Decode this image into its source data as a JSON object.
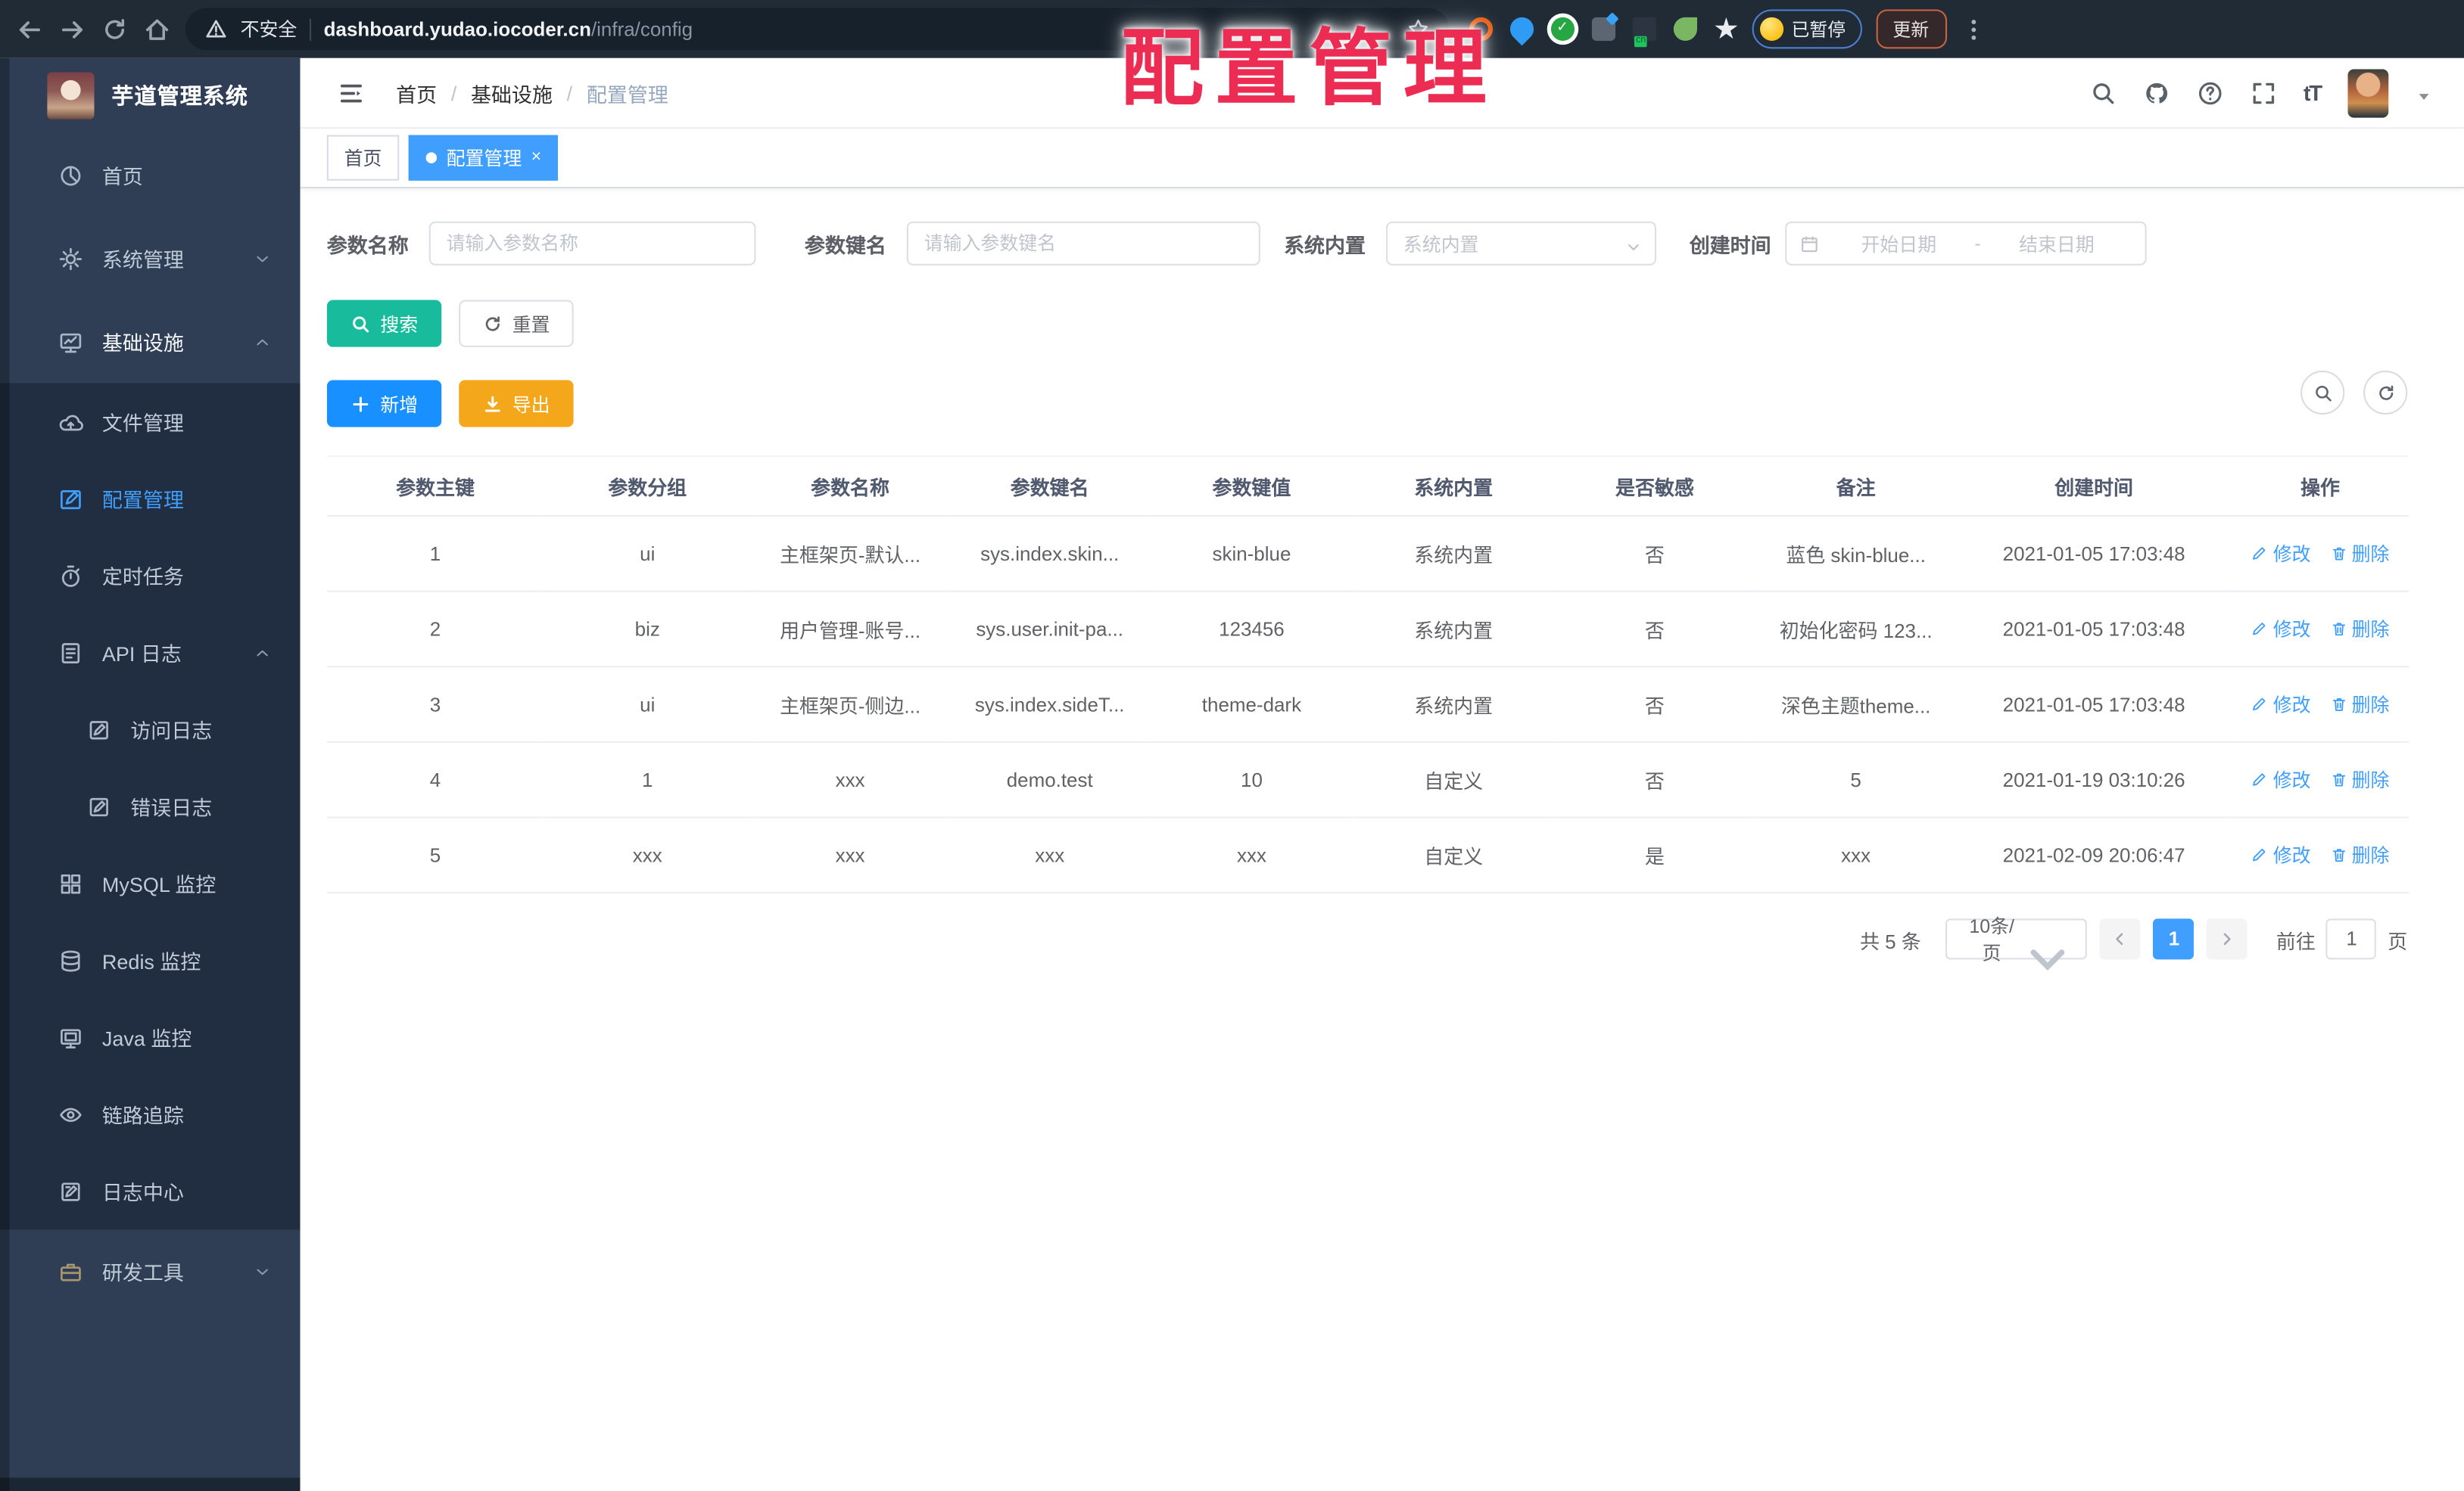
{
  "watermark": "配置管理",
  "browser": {
    "security_label": "不安全",
    "url_host": "dashboard.yudao.iocoder.cn",
    "url_path": "/infra/config",
    "paused_label": "已暂停",
    "update_label": "更新",
    "extensions": [
      "ext-orange-ring-icon",
      "ext-blue-pin-icon",
      "ext-green-check-icon",
      "ext-gray-blue-icon",
      "ext-cn-badge-icon",
      "ext-green-leaf-icon",
      "ext-puzzle-icon"
    ]
  },
  "sidebar": {
    "title": "芋道管理系统",
    "menu": [
      {
        "label": "首页",
        "icon": "dashboard-icon",
        "indent": 0,
        "dark": false,
        "chevron": null,
        "active": false,
        "open": false
      },
      {
        "label": "系统管理",
        "icon": "gear-icon",
        "indent": 0,
        "dark": false,
        "chevron": "down",
        "active": false,
        "open": false
      },
      {
        "label": "基础设施",
        "icon": "monitor-icon",
        "indent": 0,
        "dark": false,
        "chevron": "up",
        "active": false,
        "open": true
      },
      {
        "label": "文件管理",
        "icon": "cloud-upload-icon",
        "indent": 1,
        "dark": true,
        "chevron": null,
        "active": false,
        "open": false
      },
      {
        "label": "配置管理",
        "icon": "edit-square-icon",
        "indent": 1,
        "dark": true,
        "chevron": null,
        "active": true,
        "open": false
      },
      {
        "label": "定时任务",
        "icon": "timer-icon",
        "indent": 1,
        "dark": true,
        "chevron": null,
        "active": false,
        "open": false
      },
      {
        "label": "API 日志",
        "icon": "api-log-icon",
        "indent": 1,
        "dark": true,
        "chevron": "up",
        "active": false,
        "open": false
      },
      {
        "label": "访问日志",
        "icon": "doc-edit-icon",
        "indent": 2,
        "dark": true,
        "chevron": null,
        "active": false,
        "open": false
      },
      {
        "label": "错误日志",
        "icon": "doc-edit-icon",
        "indent": 2,
        "dark": true,
        "chevron": null,
        "active": false,
        "open": false
      },
      {
        "label": "MySQL 监控",
        "icon": "mysql-grid-icon",
        "indent": 1,
        "dark": true,
        "chevron": null,
        "active": false,
        "open": false
      },
      {
        "label": "Redis 监控",
        "icon": "redis-db-icon",
        "indent": 1,
        "dark": true,
        "chevron": null,
        "active": false,
        "open": false
      },
      {
        "label": "Java 监控",
        "icon": "java-monitor-icon",
        "indent": 1,
        "dark": true,
        "chevron": null,
        "active": false,
        "open": false
      },
      {
        "label": "链路追踪",
        "icon": "eye-icon",
        "indent": 1,
        "dark": true,
        "chevron": null,
        "active": false,
        "open": false
      },
      {
        "label": "日志中心",
        "icon": "log-edit-icon",
        "indent": 1,
        "dark": true,
        "chevron": null,
        "active": false,
        "open": false
      },
      {
        "label": "研发工具",
        "icon": "briefcase-icon",
        "indent": 0,
        "dark": false,
        "chevron": "down",
        "active": false,
        "open": false,
        "amber": true
      }
    ]
  },
  "header": {
    "breadcrumb": [
      "首页",
      "基础设施",
      "配置管理"
    ],
    "icons": [
      "search-icon",
      "github-icon",
      "help-icon",
      "fullscreen-icon",
      "font-size-icon",
      "avatar",
      "caret-down-icon"
    ],
    "font_size_glyph": "tT"
  },
  "tabs": [
    {
      "label": "首页",
      "active": false,
      "closable": false
    },
    {
      "label": "配置管理",
      "active": true,
      "closable": true
    }
  ],
  "filters": {
    "name_label": "参数名称",
    "name_placeholder": "请输入参数名称",
    "key_label": "参数键名",
    "key_placeholder": "请输入参数键名",
    "type_label": "系统内置",
    "type_placeholder": "系统内置",
    "date_label": "创建时间",
    "date_start_placeholder": "开始日期",
    "date_separator": "-",
    "date_end_placeholder": "结束日期",
    "search_label": "搜索",
    "reset_label": "重置"
  },
  "toolbar": {
    "add_label": "新增",
    "export_label": "导出"
  },
  "table": {
    "columns": [
      "参数主键",
      "参数分组",
      "参数名称",
      "参数键名",
      "参数键值",
      "系统内置",
      "是否敏感",
      "备注",
      "创建时间",
      "操作"
    ],
    "rows": [
      [
        "1",
        "ui",
        "主框架页-默认...",
        "sys.index.skin...",
        "skin-blue",
        "系统内置",
        "否",
        "蓝色 skin-blue...",
        "2021-01-05 17:03:48"
      ],
      [
        "2",
        "biz",
        "用户管理-账号...",
        "sys.user.init-pa...",
        "123456",
        "系统内置",
        "否",
        "初始化密码 123...",
        "2021-01-05 17:03:48"
      ],
      [
        "3",
        "ui",
        "主框架页-侧边...",
        "sys.index.sideT...",
        "theme-dark",
        "系统内置",
        "否",
        "深色主题theme...",
        "2021-01-05 17:03:48"
      ],
      [
        "4",
        "1",
        "xxx",
        "demo.test",
        "10",
        "自定义",
        "否",
        "5",
        "2021-01-19 03:10:26"
      ],
      [
        "5",
        "xxx",
        "xxx",
        "xxx",
        "xxx",
        "自定义",
        "是",
        "xxx",
        "2021-02-09 20:06:47"
      ]
    ],
    "edit_label": "修改",
    "delete_label": "删除"
  },
  "pagination": {
    "total_label": "共 5 条",
    "page_size": "10条/页",
    "current_page": "1",
    "goto_label": "前往",
    "page_unit": "页"
  },
  "colors": {
    "accent": "#409eff",
    "success": "#18bc9c",
    "warning": "#f5a71b",
    "sidebar_bg": "#2f3e54",
    "sidebar_sub_bg": "#212d40",
    "watermark_red": "#ec2c52",
    "browser_bar": "#212b36"
  }
}
